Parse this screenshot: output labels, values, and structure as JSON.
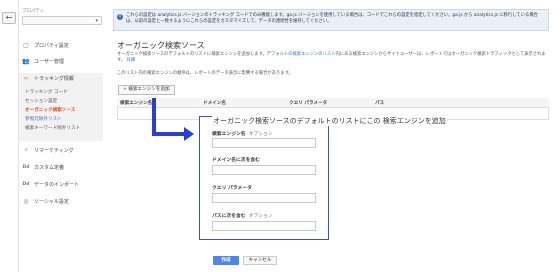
{
  "sidebar": {
    "back_icon": "arrow-left",
    "property_label": "プロパティ",
    "property_value": "",
    "items": [
      {
        "label": "プロパティ設定",
        "icon": "square-icon"
      },
      {
        "label": "ユーザー管理",
        "icon": "users-icon"
      },
      {
        "label": "トラッキング情報",
        "icon": "code-icon"
      }
    ],
    "sub_items": [
      {
        "label": "トラッキング コード"
      },
      {
        "label": "セッション設定"
      },
      {
        "label": "オーガニック検索ソース"
      },
      {
        "label": "参照元除外リスト"
      },
      {
        "label": "検索キーワード除外リスト"
      }
    ],
    "items_bottom": [
      {
        "label": "リマーケティング",
        "icon": "fork-icon"
      },
      {
        "label": "カスタム定義",
        "icon": "Dd"
      },
      {
        "label": "データのインポート",
        "icon": "Dd"
      },
      {
        "label": "ソーシャル設定",
        "icon": "globe-icon"
      }
    ]
  },
  "banner": {
    "text": "これらの設定は analytics.js バージョンのトラッキング コードでのみ機能します。ga.js バージョンを使用している場合は、コードでこれらの設定を指定してください。ga.js から analytics.js に移行している場合は、以前の設定と一致するようにこれらの設定をカスタマイズして、データの連続性を維持してください。"
  },
  "main": {
    "title": "オーガニック検索ソース",
    "description_pre": "オーガニック検索ソースのデフォルトのリストに検索エンジンを追加します。",
    "description_link": "デフォルトの検索エンジンのリスト",
    "description_post": "内にある検索エンジンからサイトユーザーは、レポートではオーガニック検索トラフィックとして表示されます。",
    "more_link": "詳細",
    "order_note": "このリスト内の検索エンジンの順序は、レポートのデータ表示に影響する場合があります。",
    "add_button": "+ 検索エンジンを追加",
    "table_headers": [
      "検索エンジン名",
      "ドメイン名",
      "クエリ パラメータ",
      "パス"
    ]
  },
  "panel": {
    "title": "オーガニック検索ソースのデフォルトのリストにこの 検索エンジンを追加",
    "fields": [
      {
        "label": "検索エンジン名",
        "optional": "オプション",
        "value": ""
      },
      {
        "label": "ドメイン名に次を含む",
        "optional": "",
        "value": ""
      },
      {
        "label": "クエリ パラメータ",
        "optional": "",
        "value": ""
      },
      {
        "label": "パスに次を含む",
        "optional": "オプション",
        "value": ""
      }
    ],
    "accent_color": "#3c4fd8"
  },
  "footer": {
    "create_label": "作成",
    "cancel_label": "キャンセル"
  }
}
